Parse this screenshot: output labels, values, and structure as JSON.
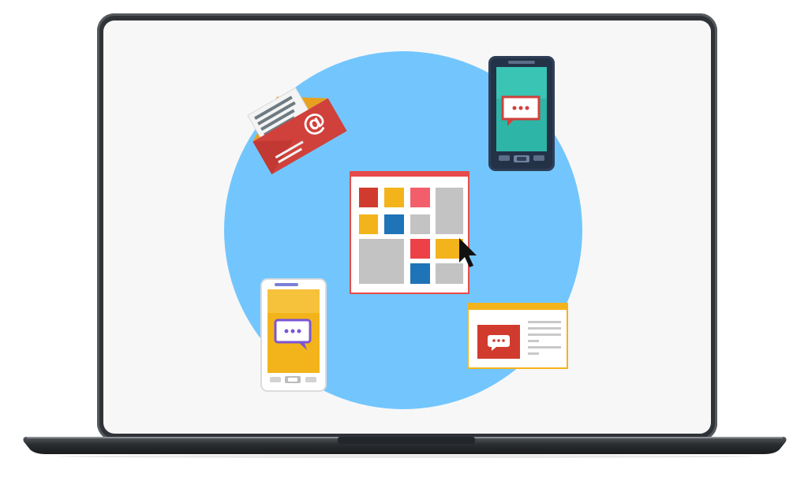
{
  "scene": {
    "colors": {
      "background": "#ffffff",
      "laptop_frame": "#2f3337",
      "screen": "#f7f7f8",
      "circle": "#72c6fd",
      "red": "#d13b2e",
      "yellow": "#f3b41b",
      "pink": "#f25f6b",
      "blue": "#1f73b7",
      "gray": "#c3c3c3",
      "teal": "#2db6a7",
      "purple": "#7a55d4"
    },
    "icons": [
      "laptop-icon",
      "email-envelope-icon",
      "smartphone-dark-chat-icon",
      "tile-dashboard-icon",
      "mouse-pointer-icon",
      "smartphone-white-chat-icon",
      "web-page-chat-icon"
    ]
  }
}
